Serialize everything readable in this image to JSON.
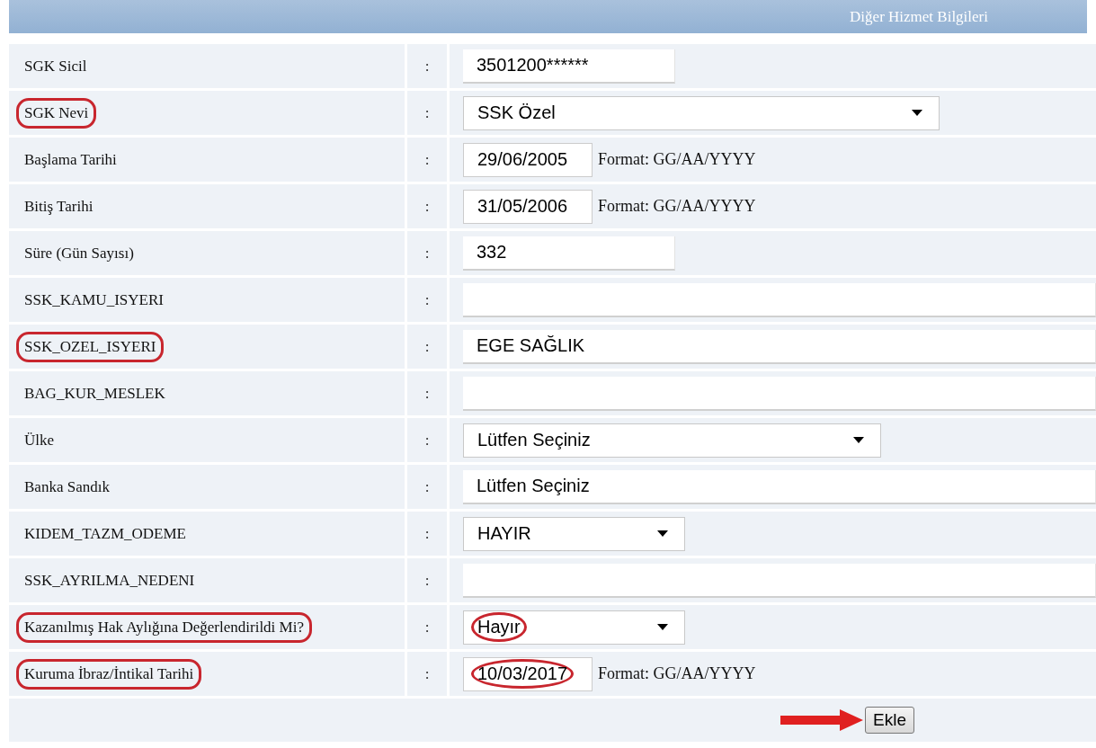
{
  "header": {
    "title": "Diğer Hizmet Bilgileri"
  },
  "rows": [
    {
      "label": "SGK Sicil",
      "kind": "input",
      "value": "3501200******",
      "label_circled": false,
      "value_circled": false
    },
    {
      "label": "SGK Nevi",
      "kind": "wide-select",
      "value": "SSK Özel",
      "label_circled": true,
      "value_circled": false
    },
    {
      "label": "Başlama Tarihi",
      "kind": "date",
      "value": "29/06/2005",
      "hint": "Format: GG/AA/YYYY",
      "label_circled": false,
      "value_circled": false
    },
    {
      "label": "Bitiş Tarihi",
      "kind": "date",
      "value": "31/05/2006",
      "hint": "Format: GG/AA/YYYY",
      "label_circled": false,
      "value_circled": false
    },
    {
      "label": "Süre (Gün Sayısı)",
      "kind": "input",
      "value": "332",
      "label_circled": false,
      "value_circled": false
    },
    {
      "label": "SSK_KAMU_ISYERI",
      "kind": "long-input",
      "label_circled": false
    },
    {
      "label": "SSK_OZEL_ISYERI",
      "kind": "long-input",
      "value": "EGE SAĞLIK",
      "label_circled": true,
      "value_circled": false
    },
    {
      "label": "BAG_KUR_MESLEK",
      "kind": "long-input",
      "label_circled": false
    },
    {
      "label": "Ülke",
      "kind": "select",
      "value": "Lütfen Seçiniz",
      "label_circled": false,
      "value_circled": false
    },
    {
      "label": "Banka Sandık",
      "kind": "long-input",
      "value": "Lütfen Seçiniz",
      "label_circled": false,
      "value_circled": false
    },
    {
      "label": "KIDEM_TAZM_ODEME",
      "kind": "narrow-select",
      "value": "HAYIR",
      "label_circled": false,
      "value_circled": false
    },
    {
      "label": "SSK_AYRILMA_NEDENI",
      "kind": "long-input",
      "label_circled": false
    },
    {
      "label": "Kazanılmış Hak Aylığına Değerlendirildi Mi?",
      "kind": "narrow-select",
      "value": "Hayır",
      "label_circled": true,
      "value_circled": true
    },
    {
      "label": "Kuruma İbraz/İntikal Tarihi",
      "kind": "date",
      "value": "10/03/2017",
      "hint": "Format: GG/AA/YYYY",
      "label_circled": true,
      "value_circled": true
    }
  ],
  "colon": ":",
  "submit": {
    "label": "Ekle"
  }
}
